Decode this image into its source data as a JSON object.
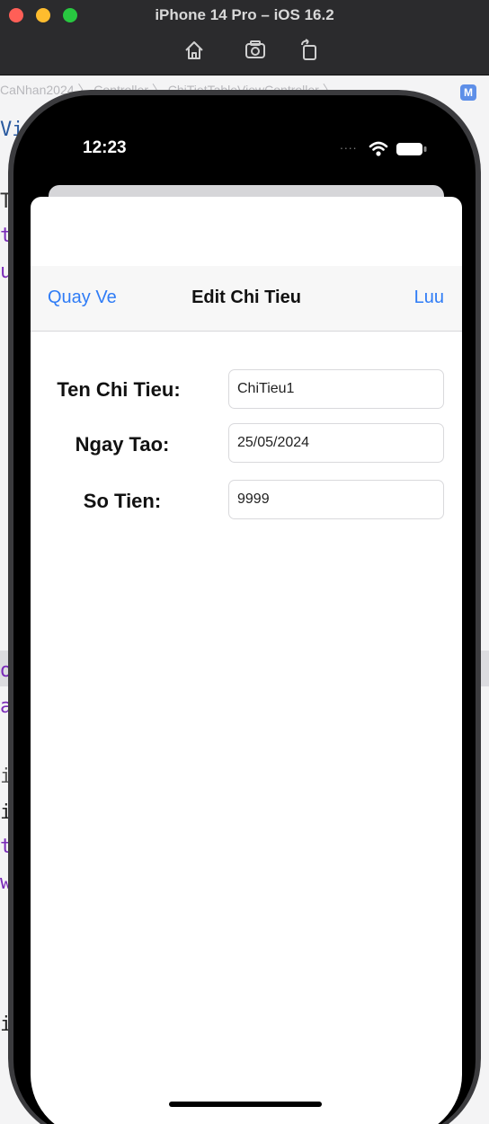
{
  "window": {
    "title": "iPhone 14 Pro – iOS 16.2",
    "toolbar": [
      {
        "name": "home-icon"
      },
      {
        "name": "screenshot-icon"
      },
      {
        "name": "rotate-icon"
      }
    ]
  },
  "xcode": {
    "breadcrumb": "CaNhan2024 〉 Controller 〉 ChiTietTableViewController 〉",
    "badge": "M"
  },
  "status_bar": {
    "time": "12:23",
    "signal": "....",
    "icons": [
      "wifi-icon",
      "battery-icon"
    ]
  },
  "nav": {
    "back_label": "Quay Ve",
    "title": "Edit Chi Tieu",
    "save_label": "Luu"
  },
  "form": {
    "fields": [
      {
        "label": "Ten Chi Tieu:",
        "value": "ChiTieu1"
      },
      {
        "label": "Ngay Tao:",
        "value": "25/05/2024"
      },
      {
        "label": "So Tien:",
        "value": "9999"
      }
    ]
  },
  "colors": {
    "accent": "#2f7cf6",
    "window_bar": "#2b2b2d"
  }
}
